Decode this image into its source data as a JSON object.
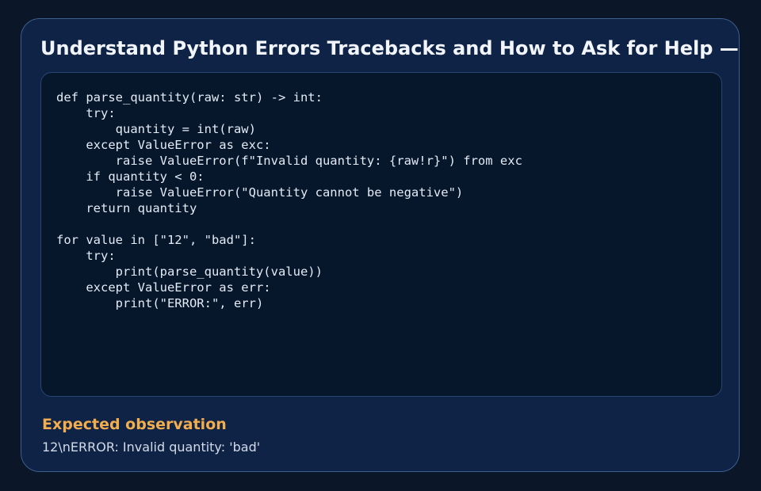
{
  "title": "Understand Python Errors Tracebacks and How to Ask for Help — w",
  "code_lines": [
    "def parse_quantity(raw: str) -> int:",
    "    try:",
    "        quantity = int(raw)",
    "    except ValueError as exc:",
    "        raise ValueError(f\"Invalid quantity: {raw!r}\") from exc",
    "    if quantity < 0:",
    "        raise ValueError(\"Quantity cannot be negative\")",
    "    return quantity",
    "",
    "for value in [\"12\", \"bad\"]:",
    "    try:",
    "        print(parse_quantity(value))",
    "    except ValueError as err:",
    "        print(\"ERROR:\", err)"
  ],
  "observation": {
    "heading": "Expected observation",
    "text": "12\\nERROR: Invalid quantity: 'bad'"
  },
  "colors": {
    "background": "#0b1628",
    "card": "#0f2346",
    "card_border": "#3d5f8f",
    "code_panel": "#06162b",
    "accent": "#f2ad4e"
  }
}
